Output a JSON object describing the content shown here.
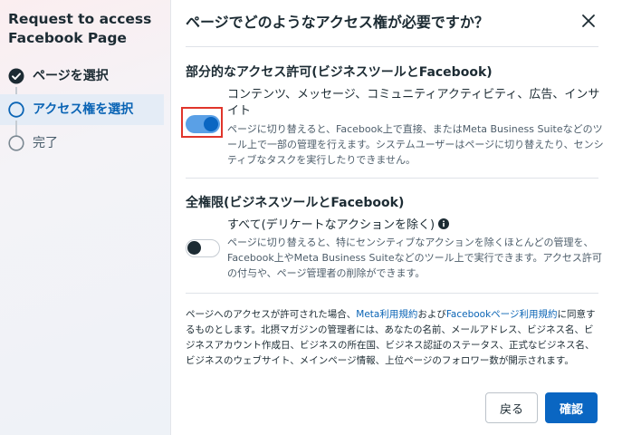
{
  "sidebar": {
    "title": "Request to access Facebook Page",
    "steps": [
      {
        "label": "ページを選択",
        "state": "done",
        "icon": "check-circle-icon"
      },
      {
        "label": "アクセス権を選択",
        "state": "active",
        "icon": "circle-outline-icon"
      },
      {
        "label": "完了",
        "state": "todo",
        "icon": "circle-outline-icon"
      }
    ]
  },
  "modal": {
    "title": "ページでどのようなアクセス権が必要ですか？",
    "partial": {
      "heading": "部分的なアクセス許可(ビジネスツールとFacebook)",
      "option_title": "コンテンツ、メッセージ、コミュニティアクティビティ、広告、インサイト",
      "option_desc": "ページに切り替えると、Facebook上で直接、またはMeta Business Suiteなどのツール上で一部の管理を行えます。システムユーザーはページに切り替えたり、センシティブなタスクを実行したりできません。",
      "toggle_on": true
    },
    "full": {
      "heading": "全権限(ビジネスツールとFacebook)",
      "option_title": "すべて(デリケートなアクションを除く)",
      "option_desc": "ページに切り替えると、特にセンシティブなアクションを除くほとんどの管理を、Facebook上やMeta Business Suiteなどのツール上で実行できます。アクセス許可の付与や、ページ管理者の削除ができます。",
      "toggle_on": false
    },
    "consent": {
      "part1": "ページへのアクセスが許可された場合、",
      "link1": "Meta利用規約",
      "part2": "および",
      "link2": "Facebookページ利用規約",
      "part3": "に同意するものとします。北摂マガジンの管理者には、あなたの名前、メールアドレス、ビジネス名、ビジネスアカウント作成日、ビジネスの所在国、ビジネス認証のステータス、正式なビジネス名、ビジネスのウェブサイト、メインページ情報、上位ページのフォロワー数が開示されます。"
    },
    "buttons": {
      "back": "戻る",
      "confirm": "確認"
    }
  },
  "colors": {
    "accent": "#0a66c2",
    "link": "#0a64b5",
    "highlight_border": "#e0352b",
    "done_check": "#1e7b3f"
  }
}
